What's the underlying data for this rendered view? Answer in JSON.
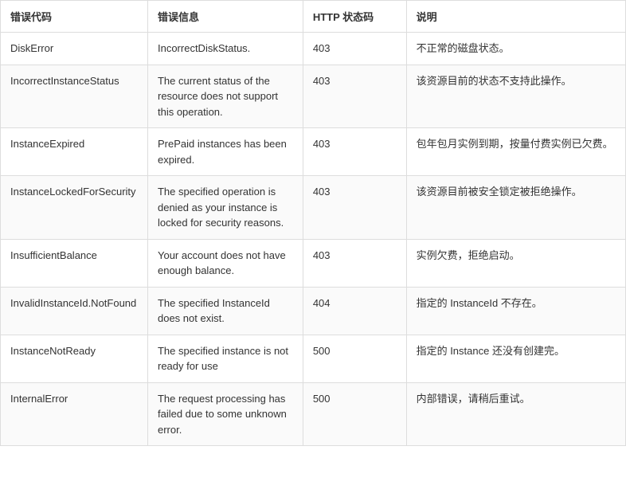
{
  "table": {
    "headers": {
      "code": "错误代码",
      "message": "错误信息",
      "http": "HTTP 状态码",
      "desc": "说明"
    },
    "rows": [
      {
        "code": "DiskError",
        "message": "IncorrectDiskStatus.",
        "http": "403",
        "desc": "不正常的磁盘状态。"
      },
      {
        "code": "IncorrectInstanceStatus",
        "message": "The current status of the resource does not support this operation.",
        "http": "403",
        "desc": "该资源目前的状态不支持此操作。"
      },
      {
        "code": "InstanceExpired",
        "message": "PrePaid instances has been expired.",
        "http": "403",
        "desc": "包年包月实例到期，按量付费实例已欠费。"
      },
      {
        "code": "InstanceLockedForSecurity",
        "message": "The specified operation is denied as your instance is locked for security reasons.",
        "http": "403",
        "desc": "该资源目前被安全锁定被拒绝操作。"
      },
      {
        "code": "InsufficientBalance",
        "message": "Your account does not have enough balance.",
        "http": "403",
        "desc": "实例欠费，拒绝启动。"
      },
      {
        "code": "InvalidInstanceId.NotFound",
        "message": "The specified InstanceId does not exist.",
        "http": "404",
        "desc": "指定的 InstanceId 不存在。"
      },
      {
        "code": "InstanceNotReady",
        "message": "The specified instance is not ready for use",
        "http": "500",
        "desc": "指定的 Instance 还没有创建完。"
      },
      {
        "code": "InternalError",
        "message": "The request processing has failed due to some unknown error.",
        "http": "500",
        "desc": "内部错误，请稍后重试。"
      }
    ]
  }
}
